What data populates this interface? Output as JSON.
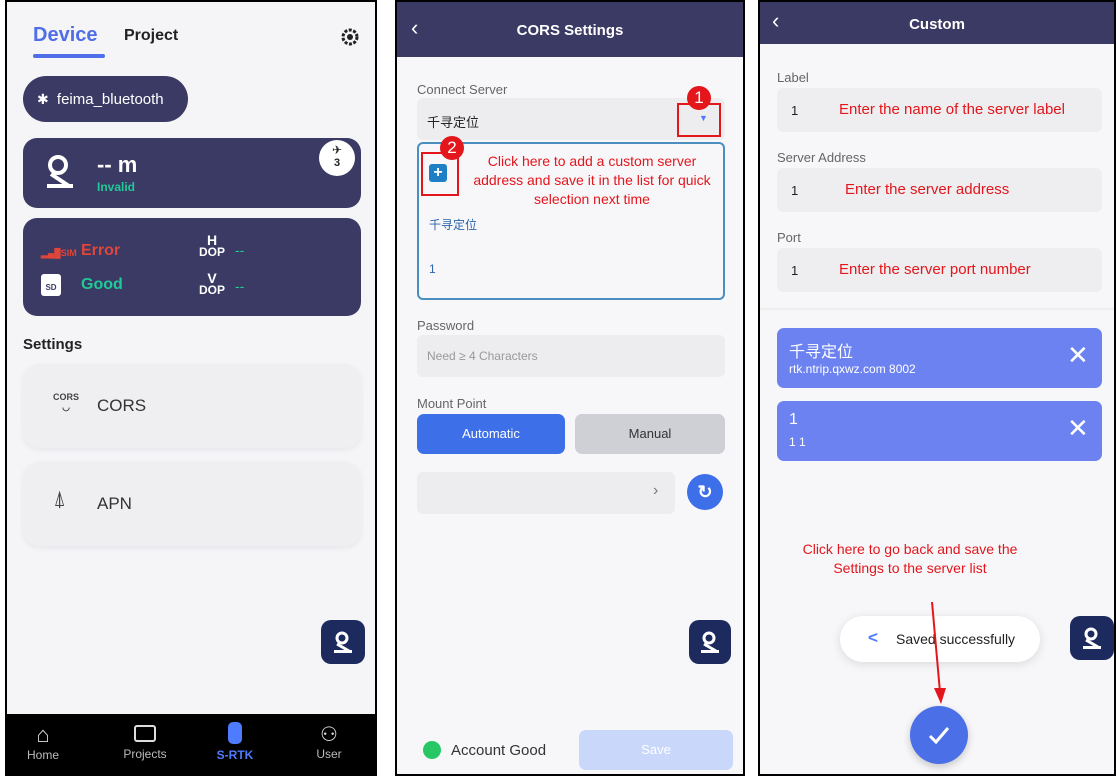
{
  "screen1": {
    "tabs": {
      "device": "Device",
      "project": "Project"
    },
    "bluetooth": {
      "label": "feima_bluetooth"
    },
    "position": {
      "value": "-- m",
      "status": "Invalid",
      "satellites": "3"
    },
    "signals": {
      "sim_status": "Error",
      "sim_icon": "SIM",
      "sd_status": "Good",
      "sd_icon": "SD",
      "hdop_top": "H",
      "hdop_bottom": "DOP",
      "hdop_value": "--",
      "vdop_top": "V",
      "vdop_bottom": "DOP",
      "vdop_value": "--"
    },
    "settings_title": "Settings",
    "cors": {
      "label": "CORS",
      "icon_text": "CORS"
    },
    "apn": {
      "label": "APN"
    },
    "nav": {
      "home": "Home",
      "projects": "Projects",
      "srtk": "S-RTK",
      "user": "User"
    },
    "colors": {
      "header_card": "#3b3a64",
      "good": "#20c997",
      "error": "#e0453a",
      "active_nav": "#4f7cff"
    }
  },
  "screen2": {
    "title": "CORS Settings",
    "connect_server_label": "Connect Server",
    "selected_server": "千寻定位",
    "marker1": "1",
    "marker2": "2",
    "annotation_add": "Click here to add a custom server address and save it in the list for quick selection next time",
    "dropdown_option_name": "千寻定位",
    "dropdown_option_value": "1",
    "password_label": "Password",
    "password_placeholder": "Need ≥ 4 Characters",
    "mount_point_label": "Mount Point",
    "automatic_label": "Automatic",
    "manual_label": "Manual",
    "account_status": "Account Good",
    "save_label": "Save"
  },
  "screen3": {
    "title": "Custom",
    "label_label": "Label",
    "label_value": "1",
    "label_hint": "Enter the name of the server label",
    "address_label": "Server Address",
    "address_value": "1",
    "address_hint": "Enter the server address",
    "port_label": "Port",
    "port_value": "1",
    "port_hint": "Enter the server port number",
    "servers": [
      {
        "name": "千寻定位",
        "detail": "rtk.ntrip.qxwz.com  8002"
      },
      {
        "name": "1",
        "detail": "1 1"
      }
    ],
    "annotation_back": "Click here to go back and save the Settings to the server list",
    "toast": "Saved successfully"
  }
}
